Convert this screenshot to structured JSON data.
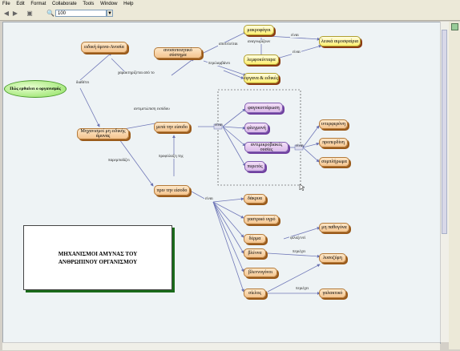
{
  "menu": [
    "File",
    "Edit",
    "Format",
    "Collaborate",
    "Tools",
    "Window",
    "Help"
  ],
  "toolbar": {
    "zoom_value": "100",
    "zoom_arrow": "▼",
    "back": "◀",
    "forward": "▶",
    "layout": "▣",
    "zoom_icon": "🔍"
  },
  "concepts": {
    "root": "Πώς ερθαίνει ο οργανισμός",
    "eidiki_anosia": "ειδική άμινα-Ανοσία",
    "anosopoitiko": "ανοσοποιητικό σύστημα",
    "makrofages": "μακροφάγοι",
    "lemfo": "λεμφοκύτταρα",
    "organa": "όργανα & ειδικές",
    "leuka": "λευκά αιμοσφαίρια",
    "mixanismoi": "Μηχανισμοί μη ειδικής άμυνας",
    "meta": "μετά την είσοδο",
    "prin": "πριν την είσοδο",
    "fagokyttarosi": "φαγοκυττάρωση",
    "flegmoni": "φλεγμονή",
    "antimikrobiakes": "αντιμικροβιακές ουσίες",
    "puretos": "πυρετός",
    "interferoni": "ιντερφερόνη",
    "properdini": "προπερδίνη",
    "symplirom": "συμπλήρωμα",
    "dakrya": "δάκρυα",
    "gastriko": "γαστρικό υγρό",
    "derma": "δέρμα",
    "vlenni": "βλέννα",
    "blennogona": "βλεννογόνοι",
    "sieloi": "σίελος",
    "kerat": "μη παθογόνα",
    "lysozymi": "λυσοζύμη",
    "galaktiko": "γαλακτικό"
  },
  "links": {
    "diathetei": "διαθέτει",
    "xaraktirizetai": "χαρακτηρίζεται από το",
    "apoteleitai": "αποτελείται",
    "perilamvanei": "περιλαμβάνει",
    "anagnorizoun": "αναγνωρίζουν",
    "einai1": "είναι",
    "einai2": "είναι",
    "antimetopisi": "αντιμετώπιση εισόδου",
    "parembodizei": "παρεμποδίζει",
    "ypoglossi": "προφύλαξη της",
    "einai3": "είναι",
    "periexei1": "φιλοξενεί",
    "periexei2": "περιέχει",
    "periexei3": "περιέχει",
    "box1": "είναι",
    "box2": "είναι"
  },
  "title_box": {
    "line1": "ΜΗΧΑΝΙΣΜΟΙ ΑΜΥΝΑΣ ΤΟΥ",
    "line2": "ΑΝΘΡΩΠΙΝΟΥ ΟΡΓΑΝΙΣΜΟΥ"
  }
}
